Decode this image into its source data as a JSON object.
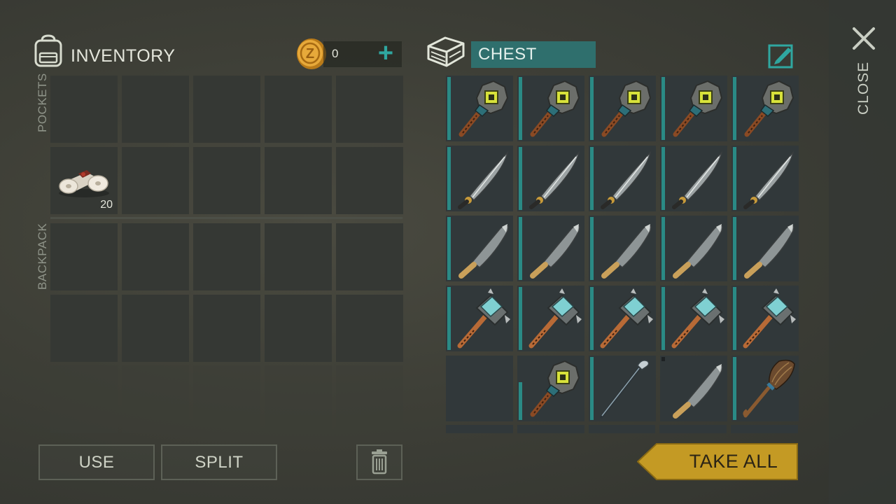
{
  "inventory": {
    "title": "INVENTORY",
    "coins": "0",
    "plus": "+",
    "sections": {
      "pockets": "POCKETS",
      "backpack": "BACKPACK"
    },
    "pocket_items": [
      {
        "slot": 5,
        "icon": "bandage-icon",
        "qty": "20"
      }
    ]
  },
  "actions": {
    "use_label": "USE",
    "split_label": "SPLIT",
    "trash_icon": "trash-icon"
  },
  "chest": {
    "title": "CHEST",
    "edit_icon": "edit-icon",
    "take_all_label": "TAKE ALL",
    "rows": [
      [
        "stone-mace-icon",
        "stone-mace-icon",
        "stone-mace-icon",
        "stone-mace-icon",
        "stone-mace-icon"
      ],
      [
        "curved-sword-icon",
        "curved-sword-icon",
        "curved-sword-icon",
        "curved-sword-icon",
        "curved-sword-icon"
      ],
      [
        "machete-icon",
        "machete-icon",
        "machete-icon",
        "machete-icon",
        "machete-icon"
      ],
      [
        "sledgehammer-icon",
        "sledgehammer-icon",
        "sledgehammer-icon",
        "sledgehammer-icon",
        "sledgehammer-icon"
      ],
      [
        "empty",
        "stone-mace-icon",
        "golf-club-icon",
        "machete-icon",
        "broom-icon"
      ]
    ]
  },
  "side": {
    "close_label": "CLOSE"
  },
  "colors": {
    "accent": "#2fa7a0",
    "chest_header": "#2f6f6d",
    "take_all": "#c49a24"
  }
}
